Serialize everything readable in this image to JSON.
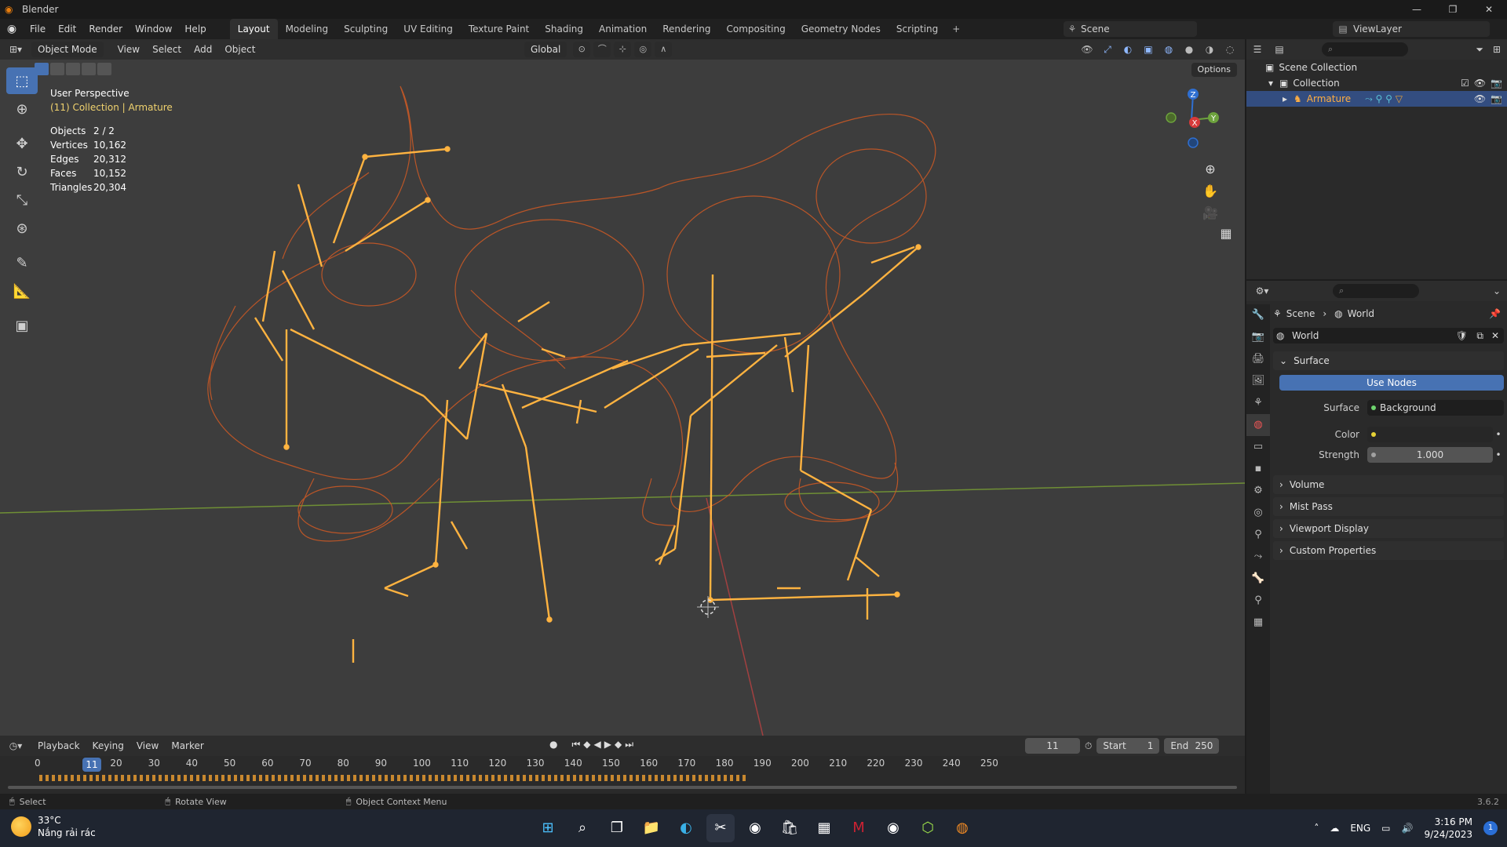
{
  "window": {
    "title": "Blender",
    "controls": [
      "—",
      "❐",
      "✕"
    ]
  },
  "menubar": {
    "items": [
      "File",
      "Edit",
      "Render",
      "Window",
      "Help"
    ],
    "tabs": [
      "Layout",
      "Modeling",
      "Sculpting",
      "UV Editing",
      "Texture Paint",
      "Shading",
      "Animation",
      "Rendering",
      "Compositing",
      "Geometry Nodes",
      "Scripting"
    ],
    "active_tab": "Layout",
    "scene": "Scene",
    "view_layer": "ViewLayer"
  },
  "viewport": {
    "mode": "Object Mode",
    "menus": [
      "View",
      "Select",
      "Add",
      "Object"
    ],
    "orientation": "Global",
    "options_label": "Options",
    "perspective": "User Perspective",
    "collection_label": "(11) Collection | Armature",
    "stats": [
      {
        "label": "Objects",
        "value": "2 / 2"
      },
      {
        "label": "Vertices",
        "value": "10,162"
      },
      {
        "label": "Edges",
        "value": "20,312"
      },
      {
        "label": "Faces",
        "value": "10,152"
      },
      {
        "label": "Triangles",
        "value": "20,304"
      }
    ],
    "gizmo": {
      "z": "Z",
      "y": "Y",
      "x": "X"
    },
    "colors": {
      "wire": "#e0672c",
      "bone": "#ffb340",
      "bg": "#3d3d3d",
      "x_axis": "#c84a4a",
      "y_axis": "#7ea33b"
    }
  },
  "outliner": {
    "scene_collection": "Scene Collection",
    "collection": "Collection",
    "armature": "Armature"
  },
  "properties": {
    "crumb_scene": "Scene",
    "crumb_world": "World",
    "world_name": "World",
    "surface_panel": "Surface",
    "use_nodes": "Use Nodes",
    "surface_label": "Surface",
    "surface_value": "Background",
    "color_label": "Color",
    "strength_label": "Strength",
    "strength_value": "1.000",
    "panels": [
      "Volume",
      "Mist Pass",
      "Viewport Display",
      "Custom Properties"
    ]
  },
  "timeline": {
    "menus": [
      "Playback",
      "Keying",
      "View",
      "Marker"
    ],
    "current_frame": "11",
    "start_label": "Start",
    "start": "1",
    "end_label": "End",
    "end": "250",
    "ruler": [
      "0",
      "20",
      "30",
      "40",
      "50",
      "60",
      "70",
      "80",
      "90",
      "100",
      "110",
      "120",
      "130",
      "140",
      "150",
      "160",
      "170",
      "180",
      "190",
      "200",
      "210",
      "220",
      "230",
      "240",
      "250"
    ]
  },
  "statusbar": {
    "select": "Select",
    "rotate": "Rotate View",
    "context": "Object Context Menu",
    "version": "3.6.2"
  },
  "taskbar": {
    "temp": "33°C",
    "weather": "Nắng rải rác",
    "lang": "ENG",
    "time": "3:16 PM",
    "date": "9/24/2023",
    "notifications": "1"
  }
}
